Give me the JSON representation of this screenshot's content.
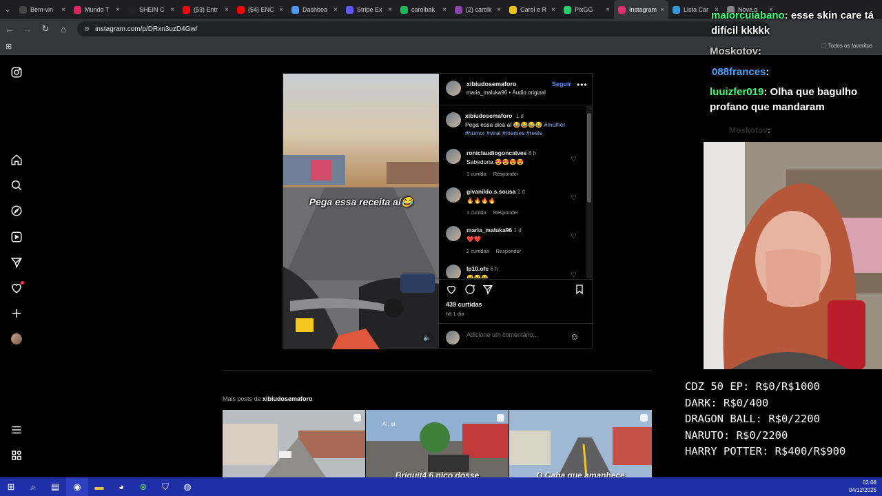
{
  "browser": {
    "tabs": [
      {
        "title": "Bem-vin",
        "color": "#444"
      },
      {
        "title": "Mundo T",
        "color": "#e0245e"
      },
      {
        "title": "SHEIN C",
        "color": "#222"
      },
      {
        "title": "(53) Entr",
        "color": "#ff0000"
      },
      {
        "title": "(54) ENC",
        "color": "#ff0000"
      },
      {
        "title": "Dashboa",
        "color": "#4b9bff"
      },
      {
        "title": "Stripe Ex",
        "color": "#635bff"
      },
      {
        "title": "carolbak",
        "color": "#1db954"
      },
      {
        "title": "(2) carolk",
        "color": "#8e44ad"
      },
      {
        "title": "Carol e R",
        "color": "#f1c40f"
      },
      {
        "title": "PixGG",
        "color": "#2ecc71"
      },
      {
        "title": "Instagram",
        "color": "#e1306c"
      },
      {
        "title": "Lista Car",
        "color": "#3498db"
      },
      {
        "title": "Nova g",
        "color": "#888"
      }
    ],
    "url": "instagram.com/p/DRxn3uzD4Gw/",
    "bookmarks_all": "Todos os favoritos"
  },
  "post": {
    "username": "xibiudosemaforo",
    "follow": "Seguir",
    "audio_user": "maria_maluka96",
    "audio_label": "• Áudio original",
    "video_caption": "Pega essa receita aí😂",
    "caption_user": "xibiudosemaforo",
    "caption_time": "1 d",
    "caption_text": "Pega essa dica aí 😂😂😂😂",
    "caption_tags": "#mulher #humor #viral #memes #reels",
    "comments": [
      {
        "user": "roniclaudiogoncalves",
        "time": "8 h",
        "text": "Sabedoria.😍😍😍😍",
        "likes": "1 curtida",
        "reply": "Responder"
      },
      {
        "user": "givanildo.s.sousa",
        "time": "1 d",
        "text": "🔥🔥🔥🔥",
        "likes": "1 curtida",
        "reply": "Responder"
      },
      {
        "user": "maria_maluka96",
        "time": "1 d",
        "text": "❤️❤️",
        "likes": "2 curtidas",
        "reply": "Responder"
      },
      {
        "user": "lp10.ofc",
        "time": "6 h",
        "text": "😆😆😆",
        "likes": "",
        "reply": ""
      }
    ],
    "likes": "439 curtidas",
    "posted": "há 1 dia",
    "comment_placeholder": "Adicione um comentário..."
  },
  "more_posts": {
    "prefix": "Mais posts de",
    "user": "xibiudosemaforo",
    "thumb_captions": [
      "",
      "Briquit4 6 nico dosse",
      "O Caba que amanhece"
    ],
    "thumb_overlay_text": "Aí, ai"
  },
  "stream": {
    "chat": [
      {
        "user": "maiorcuiabano",
        "msg": ": esse skin care tá difícil kkkkk",
        "color": "#3cff7a"
      },
      {
        "user": "Moskotov",
        "msg": ":",
        "color": "#c8c8c8"
      },
      {
        "user": "088frances",
        "msg": ":",
        "color": "#4aa3ff"
      },
      {
        "user": "luuizfer019",
        "msg": ": Olha que bagulho profano que mandaram",
        "color": "#3cff7a"
      },
      {
        "user": "Moskotov",
        "msg": ":",
        "color": "#555555"
      }
    ],
    "goals": [
      "CDZ 50 EP: R$0/R$1000",
      "DARK: R$0/400",
      "DRAGON BALL: R$0/2200",
      "NARUTO: R$0/2200",
      "HARRY POTTER: R$400/R$900"
    ]
  },
  "taskbar": {
    "time": "02:08",
    "date": "04/12/2025"
  }
}
